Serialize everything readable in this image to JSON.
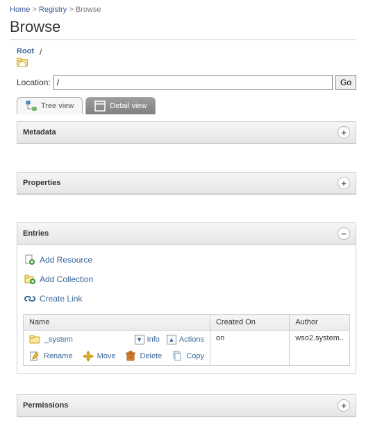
{
  "breadcrumb": {
    "home": "Home",
    "sep": ">",
    "registry": "Registry",
    "browse": "Browse"
  },
  "title": "Browse",
  "root": {
    "label": "Root",
    "slash": "/"
  },
  "location": {
    "label": "Location:",
    "value": "/",
    "go": "Go"
  },
  "tabs": {
    "tree": "Tree view",
    "detail": "Detail view"
  },
  "panels": {
    "metadata": {
      "title": "Metadata"
    },
    "properties": {
      "title": "Properties"
    },
    "entries": {
      "title": "Entries",
      "addResource": "Add Resource",
      "addCollection": "Add Collection",
      "createLink": "Create Link",
      "cols": {
        "name": "Name",
        "created": "Created On",
        "author": "Author"
      },
      "row": {
        "name": "_system",
        "created": "on",
        "author": "wso2.system..",
        "info": "Info",
        "actions": "Actions",
        "rename": "Rename",
        "move": "Move",
        "delete": "Delete",
        "copy": "Copy"
      }
    },
    "permissions": {
      "title": "Permissions"
    }
  }
}
